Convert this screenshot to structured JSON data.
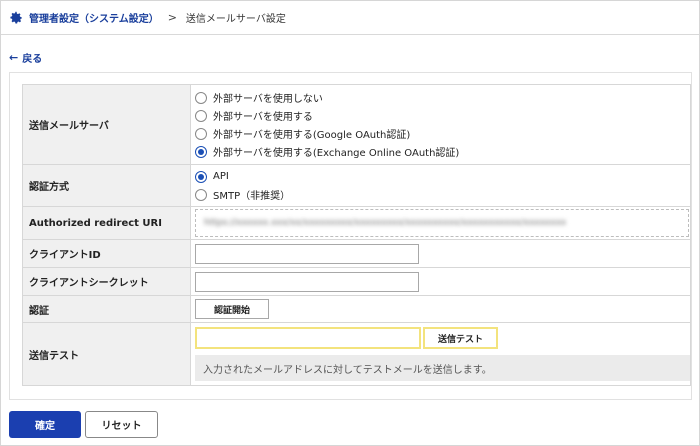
{
  "breadcrumb": {
    "parent": "管理者設定（システム設定）",
    "separator": ">",
    "current": "送信メールサーバ設定"
  },
  "back": {
    "arrow": "←",
    "label": "戻る"
  },
  "form": {
    "mail_server": {
      "label": "送信メールサーバ",
      "options": [
        {
          "label": "外部サーバを使用しない",
          "selected": false
        },
        {
          "label": "外部サーバを使用する",
          "selected": false
        },
        {
          "label": "外部サーバを使用する(Google OAuth認証)",
          "selected": false
        },
        {
          "label": "外部サーバを使用する(Exchange Online OAuth認証)",
          "selected": true
        }
      ]
    },
    "auth_method": {
      "label": "認証方式",
      "options": [
        {
          "label": "API",
          "selected": true
        },
        {
          "label": "SMTP（非推奨）",
          "selected": false
        }
      ]
    },
    "redirect_uri": {
      "label": "Authorized redirect URI",
      "value": "https://xxxxxx.xxx/xx/xxxxxxxxx/xxxxxxxxx/xxxxxxxxxx/xxxxxxxxxxx/xxxxxxxx"
    },
    "client_id": {
      "label": "クライアントID",
      "value": ""
    },
    "client_secret": {
      "label": "クライアントシークレット",
      "value": ""
    },
    "auth": {
      "label": "認証",
      "button": "認証開始"
    },
    "send_test": {
      "label": "送信テスト",
      "value": "",
      "button": "送信テスト",
      "note": "入力されたメールアドレスに対してテストメールを送信します。"
    }
  },
  "actions": {
    "confirm": "確定",
    "reset": "リセット"
  },
  "colors": {
    "primary": "#1b3fb0",
    "link": "#1a3f9c",
    "highlight": "#f3e37d",
    "label_bg": "#f0f0f0"
  }
}
